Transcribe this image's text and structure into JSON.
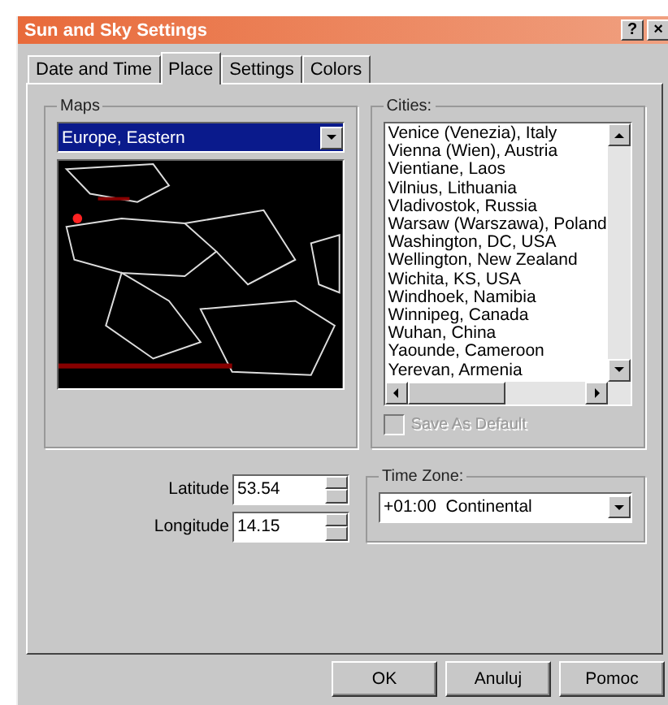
{
  "window": {
    "title": "Sun and Sky Settings",
    "title_buttons": [
      "?",
      "×"
    ]
  },
  "tabs": [
    {
      "label": "Date and Time",
      "selected": false
    },
    {
      "label": "Place",
      "selected": true
    },
    {
      "label": "Settings",
      "selected": false
    },
    {
      "label": "Colors",
      "selected": false
    }
  ],
  "maps": {
    "label": "Maps",
    "value": "Europe, Eastern"
  },
  "cities": {
    "label": "Cities:",
    "items": [
      "Venice (Venezia), Italy",
      "Vienna (Wien), Austria",
      "Vientiane, Laos",
      "Vilnius, Lithuania",
      "Vladivostok, Russia",
      "Warsaw (Warszawa), Poland",
      "Washington, DC, USA",
      "Wellington, New Zealand",
      "Wichita, KS, USA",
      "Windhoek, Namibia",
      "Winnipeg, Canada",
      "Wuhan, China",
      "Yaounde, Cameroon",
      "Yerevan, Armenia"
    ]
  },
  "save_as_default": {
    "label": "Save As Default",
    "checked": false,
    "disabled": true
  },
  "coordinates": [
    {
      "label": "Latitude",
      "value": "53.54"
    },
    {
      "label": "Longitude",
      "value": "14.15"
    }
  ],
  "time_zone": {
    "label": "Time Zone:",
    "value": "+01:00  Continental"
  },
  "buttons": [
    "OK",
    "Anuluj",
    "Pomoc"
  ]
}
